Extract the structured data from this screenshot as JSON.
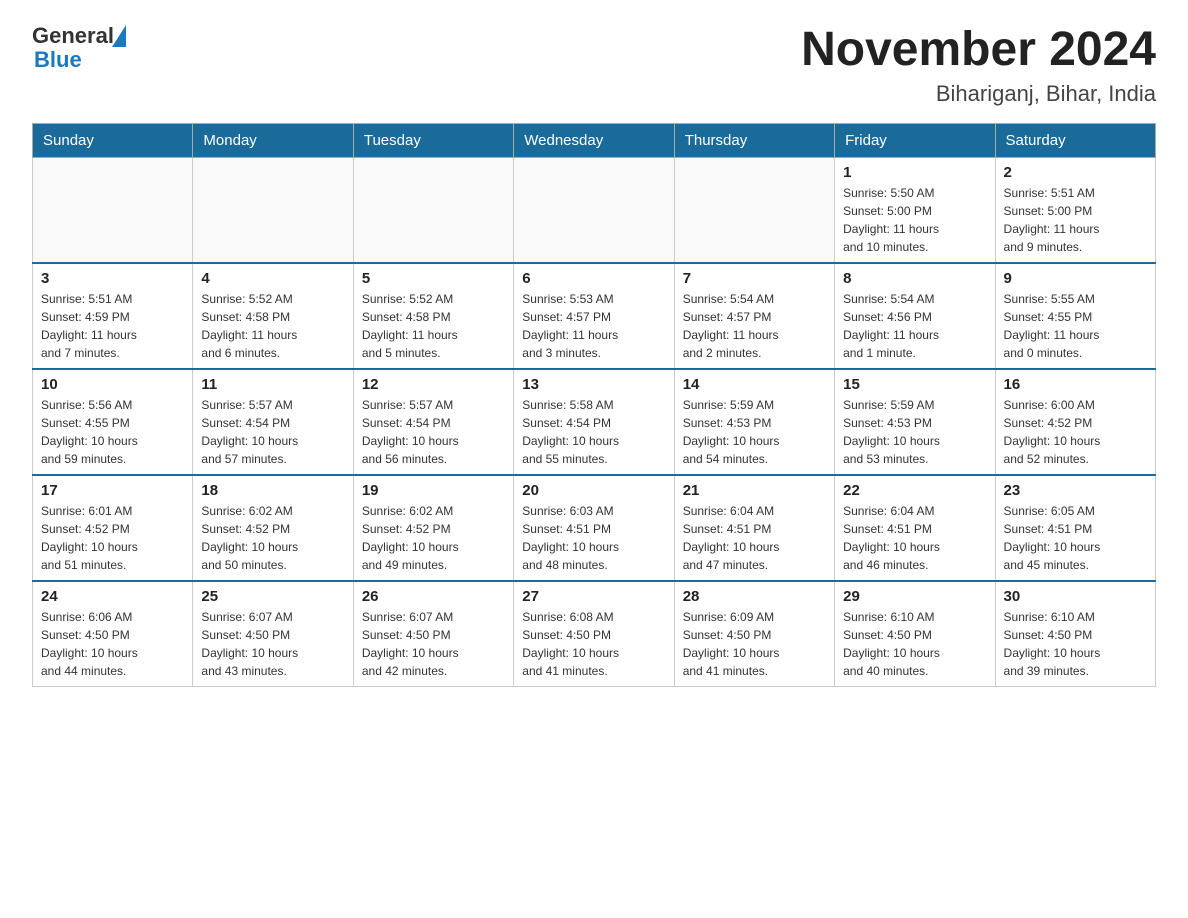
{
  "header": {
    "logo": {
      "text_general": "General",
      "text_blue": "Blue"
    },
    "title": "November 2024",
    "subtitle": "Bihariganj, Bihar, India"
  },
  "weekdays": [
    "Sunday",
    "Monday",
    "Tuesday",
    "Wednesday",
    "Thursday",
    "Friday",
    "Saturday"
  ],
  "weeks": [
    [
      {
        "day": "",
        "info": ""
      },
      {
        "day": "",
        "info": ""
      },
      {
        "day": "",
        "info": ""
      },
      {
        "day": "",
        "info": ""
      },
      {
        "day": "",
        "info": ""
      },
      {
        "day": "1",
        "info": "Sunrise: 5:50 AM\nSunset: 5:00 PM\nDaylight: 11 hours\nand 10 minutes."
      },
      {
        "day": "2",
        "info": "Sunrise: 5:51 AM\nSunset: 5:00 PM\nDaylight: 11 hours\nand 9 minutes."
      }
    ],
    [
      {
        "day": "3",
        "info": "Sunrise: 5:51 AM\nSunset: 4:59 PM\nDaylight: 11 hours\nand 7 minutes."
      },
      {
        "day": "4",
        "info": "Sunrise: 5:52 AM\nSunset: 4:58 PM\nDaylight: 11 hours\nand 6 minutes."
      },
      {
        "day": "5",
        "info": "Sunrise: 5:52 AM\nSunset: 4:58 PM\nDaylight: 11 hours\nand 5 minutes."
      },
      {
        "day": "6",
        "info": "Sunrise: 5:53 AM\nSunset: 4:57 PM\nDaylight: 11 hours\nand 3 minutes."
      },
      {
        "day": "7",
        "info": "Sunrise: 5:54 AM\nSunset: 4:57 PM\nDaylight: 11 hours\nand 2 minutes."
      },
      {
        "day": "8",
        "info": "Sunrise: 5:54 AM\nSunset: 4:56 PM\nDaylight: 11 hours\nand 1 minute."
      },
      {
        "day": "9",
        "info": "Sunrise: 5:55 AM\nSunset: 4:55 PM\nDaylight: 11 hours\nand 0 minutes."
      }
    ],
    [
      {
        "day": "10",
        "info": "Sunrise: 5:56 AM\nSunset: 4:55 PM\nDaylight: 10 hours\nand 59 minutes."
      },
      {
        "day": "11",
        "info": "Sunrise: 5:57 AM\nSunset: 4:54 PM\nDaylight: 10 hours\nand 57 minutes."
      },
      {
        "day": "12",
        "info": "Sunrise: 5:57 AM\nSunset: 4:54 PM\nDaylight: 10 hours\nand 56 minutes."
      },
      {
        "day": "13",
        "info": "Sunrise: 5:58 AM\nSunset: 4:54 PM\nDaylight: 10 hours\nand 55 minutes."
      },
      {
        "day": "14",
        "info": "Sunrise: 5:59 AM\nSunset: 4:53 PM\nDaylight: 10 hours\nand 54 minutes."
      },
      {
        "day": "15",
        "info": "Sunrise: 5:59 AM\nSunset: 4:53 PM\nDaylight: 10 hours\nand 53 minutes."
      },
      {
        "day": "16",
        "info": "Sunrise: 6:00 AM\nSunset: 4:52 PM\nDaylight: 10 hours\nand 52 minutes."
      }
    ],
    [
      {
        "day": "17",
        "info": "Sunrise: 6:01 AM\nSunset: 4:52 PM\nDaylight: 10 hours\nand 51 minutes."
      },
      {
        "day": "18",
        "info": "Sunrise: 6:02 AM\nSunset: 4:52 PM\nDaylight: 10 hours\nand 50 minutes."
      },
      {
        "day": "19",
        "info": "Sunrise: 6:02 AM\nSunset: 4:52 PM\nDaylight: 10 hours\nand 49 minutes."
      },
      {
        "day": "20",
        "info": "Sunrise: 6:03 AM\nSunset: 4:51 PM\nDaylight: 10 hours\nand 48 minutes."
      },
      {
        "day": "21",
        "info": "Sunrise: 6:04 AM\nSunset: 4:51 PM\nDaylight: 10 hours\nand 47 minutes."
      },
      {
        "day": "22",
        "info": "Sunrise: 6:04 AM\nSunset: 4:51 PM\nDaylight: 10 hours\nand 46 minutes."
      },
      {
        "day": "23",
        "info": "Sunrise: 6:05 AM\nSunset: 4:51 PM\nDaylight: 10 hours\nand 45 minutes."
      }
    ],
    [
      {
        "day": "24",
        "info": "Sunrise: 6:06 AM\nSunset: 4:50 PM\nDaylight: 10 hours\nand 44 minutes."
      },
      {
        "day": "25",
        "info": "Sunrise: 6:07 AM\nSunset: 4:50 PM\nDaylight: 10 hours\nand 43 minutes."
      },
      {
        "day": "26",
        "info": "Sunrise: 6:07 AM\nSunset: 4:50 PM\nDaylight: 10 hours\nand 42 minutes."
      },
      {
        "day": "27",
        "info": "Sunrise: 6:08 AM\nSunset: 4:50 PM\nDaylight: 10 hours\nand 41 minutes."
      },
      {
        "day": "28",
        "info": "Sunrise: 6:09 AM\nSunset: 4:50 PM\nDaylight: 10 hours\nand 41 minutes."
      },
      {
        "day": "29",
        "info": "Sunrise: 6:10 AM\nSunset: 4:50 PM\nDaylight: 10 hours\nand 40 minutes."
      },
      {
        "day": "30",
        "info": "Sunrise: 6:10 AM\nSunset: 4:50 PM\nDaylight: 10 hours\nand 39 minutes."
      }
    ]
  ]
}
